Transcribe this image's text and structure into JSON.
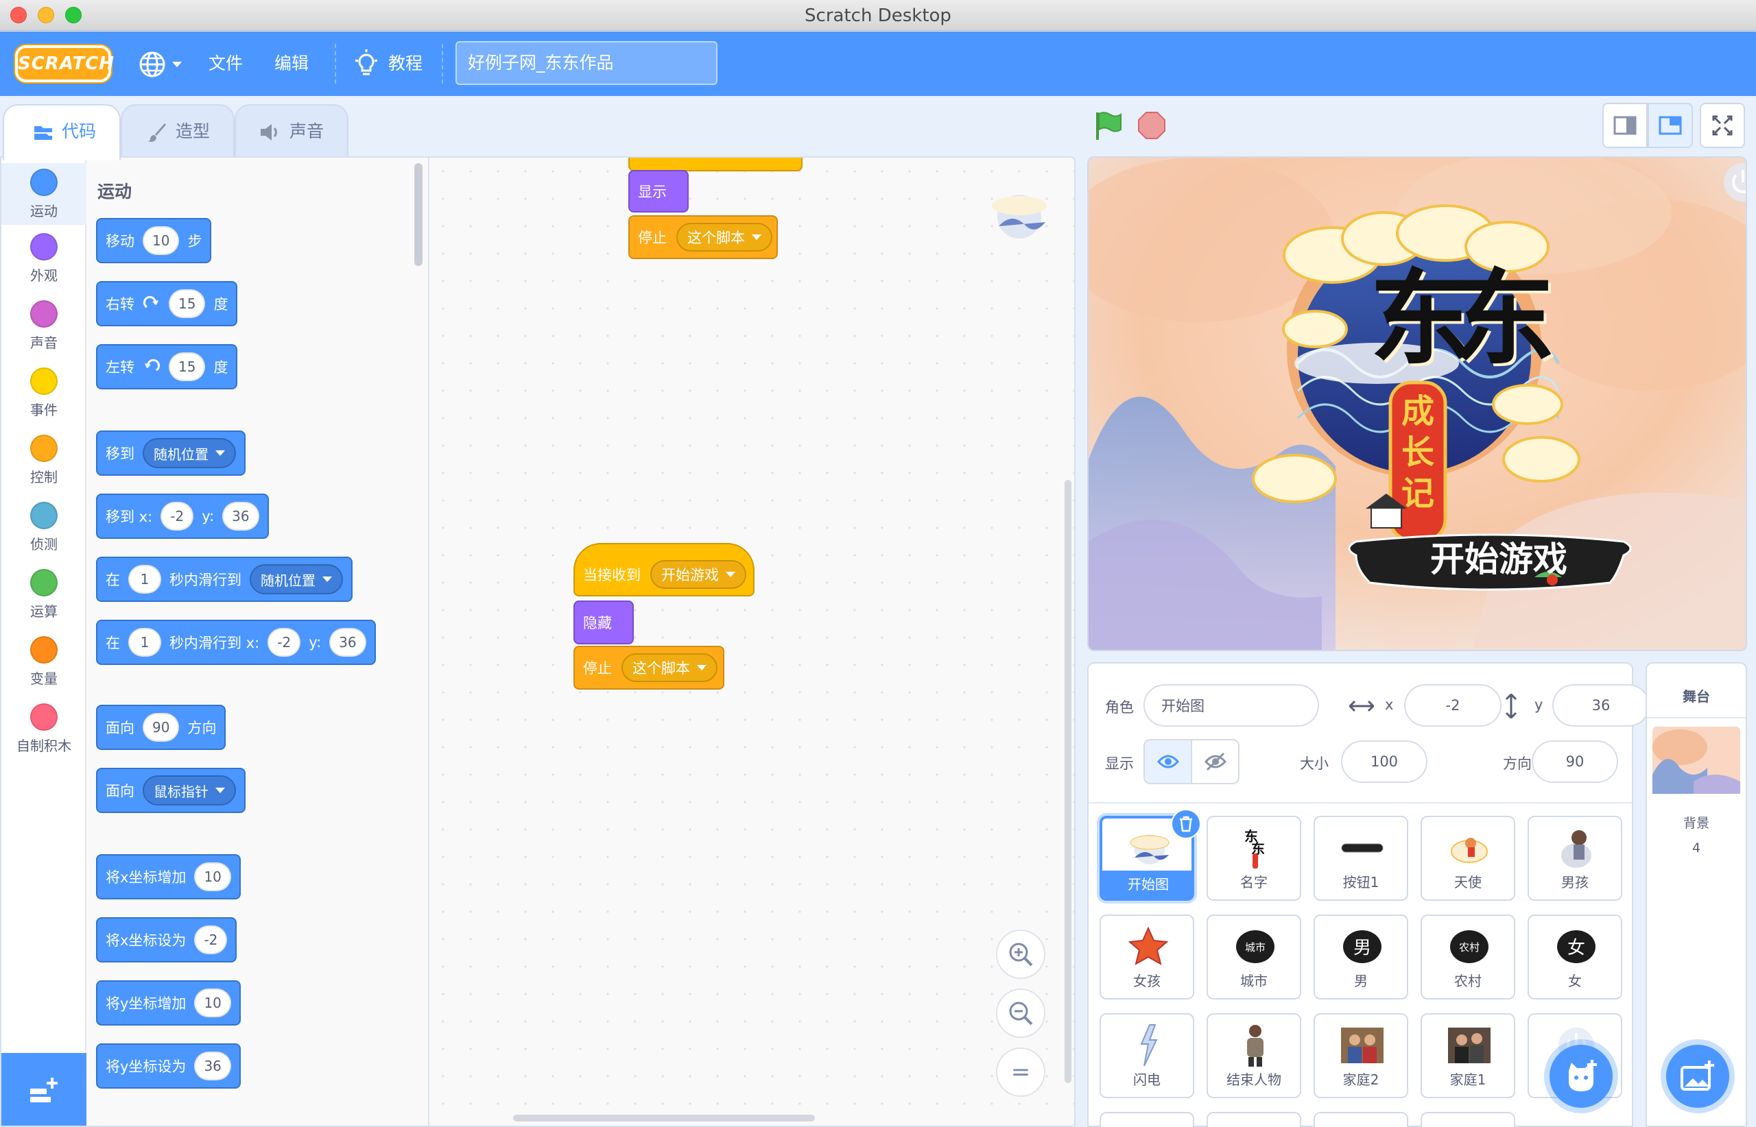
{
  "window": {
    "title": "Scratch Desktop"
  },
  "menubar": {
    "logo": "SCRATCH",
    "file": "文件",
    "edit": "编辑",
    "tutorials": "教程",
    "project_title": "好例子网_东东作品"
  },
  "tabs": [
    {
      "label": "代码",
      "active": true
    },
    {
      "label": "造型",
      "active": false
    },
    {
      "label": "声音",
      "active": false
    }
  ],
  "categories": [
    {
      "label": "运动",
      "color": "#4c97ff"
    },
    {
      "label": "外观",
      "color": "#9966ff"
    },
    {
      "label": "声音",
      "color": "#cf63cf"
    },
    {
      "label": "事件",
      "color": "#ffd500"
    },
    {
      "label": "控制",
      "color": "#ffab19"
    },
    {
      "label": "侦测",
      "color": "#5cb1d6"
    },
    {
      "label": "运算",
      "color": "#59c059"
    },
    {
      "label": "变量",
      "color": "#ff8c1a"
    },
    {
      "label": "自制积木",
      "color": "#ff6680"
    }
  ],
  "palette": {
    "title": "运动",
    "move": {
      "a": "移动",
      "v": "10",
      "b": "步"
    },
    "turn_right": {
      "a": "右转",
      "v": "15",
      "b": "度"
    },
    "turn_left": {
      "a": "左转",
      "v": "15",
      "b": "度"
    },
    "goto": {
      "a": "移到",
      "dd": "随机位置"
    },
    "goto_xy": {
      "a": "移到 x:",
      "x": "-2",
      "b": "y:",
      "y": "36"
    },
    "glide": {
      "a": "在",
      "v": "1",
      "b": "秒内滑行到",
      "dd": "随机位置"
    },
    "glide_xy": {
      "a": "在",
      "v": "1",
      "b": "秒内滑行到 x:",
      "x": "-2",
      "c": "y:",
      "y": "36"
    },
    "point_dir": {
      "a": "面向",
      "v": "90",
      "b": "方向"
    },
    "point_towards": {
      "a": "面向",
      "dd": "鼠标指针"
    },
    "change_x": {
      "a": "将x坐标增加",
      "v": "10"
    },
    "set_x": {
      "a": "将x坐标设为",
      "v": "-2"
    },
    "change_y": {
      "a": "将y坐标增加",
      "v": "10"
    },
    "set_y": {
      "a": "将y坐标设为",
      "v": "36"
    }
  },
  "scripts": {
    "top": {
      "show": "显示",
      "stop": "停止",
      "stop_dd": "这个脚本"
    },
    "main": {
      "when": "当接收到",
      "msg": "开始游戏",
      "hide": "隐藏",
      "stop": "停止",
      "stop_dd": "这个脚本"
    }
  },
  "zoom": {
    "reset": "="
  },
  "stage": {
    "title_big": "东东",
    "title_vertical": [
      "成",
      "长",
      "记"
    ],
    "button": "开始游戏"
  },
  "sprite_info": {
    "sprite_label": "角色",
    "sprite_name": "开始图",
    "x_label": "x",
    "x": "-2",
    "y_label": "y",
    "y": "36",
    "show_label": "显示",
    "size_label": "大小",
    "size": "100",
    "direction_label": "方向",
    "direction": "90"
  },
  "sprites": [
    {
      "name": "开始图",
      "selected": true
    },
    {
      "name": "名字"
    },
    {
      "name": "按钮1"
    },
    {
      "name": "天使"
    },
    {
      "name": "男孩"
    },
    {
      "name": "女孩"
    },
    {
      "name": "城市",
      "glyph": "城市"
    },
    {
      "name": "男",
      "glyph": "男"
    },
    {
      "name": "农村",
      "glyph": "农村"
    },
    {
      "name": "女",
      "glyph": "女"
    },
    {
      "name": "闪电"
    },
    {
      "name": "结束人物"
    },
    {
      "name": "家庭2"
    },
    {
      "name": "家庭1"
    },
    {
      "name": ""
    }
  ],
  "stage_pane": {
    "title": "舞台",
    "backdrop_label": "背景",
    "backdrop_count": "4"
  },
  "colors": {
    "motion": "#4c97ff",
    "looks": "#9966ff",
    "events": "#ffbf00",
    "control": "#ffab19",
    "menubar": "#4c97ff"
  }
}
